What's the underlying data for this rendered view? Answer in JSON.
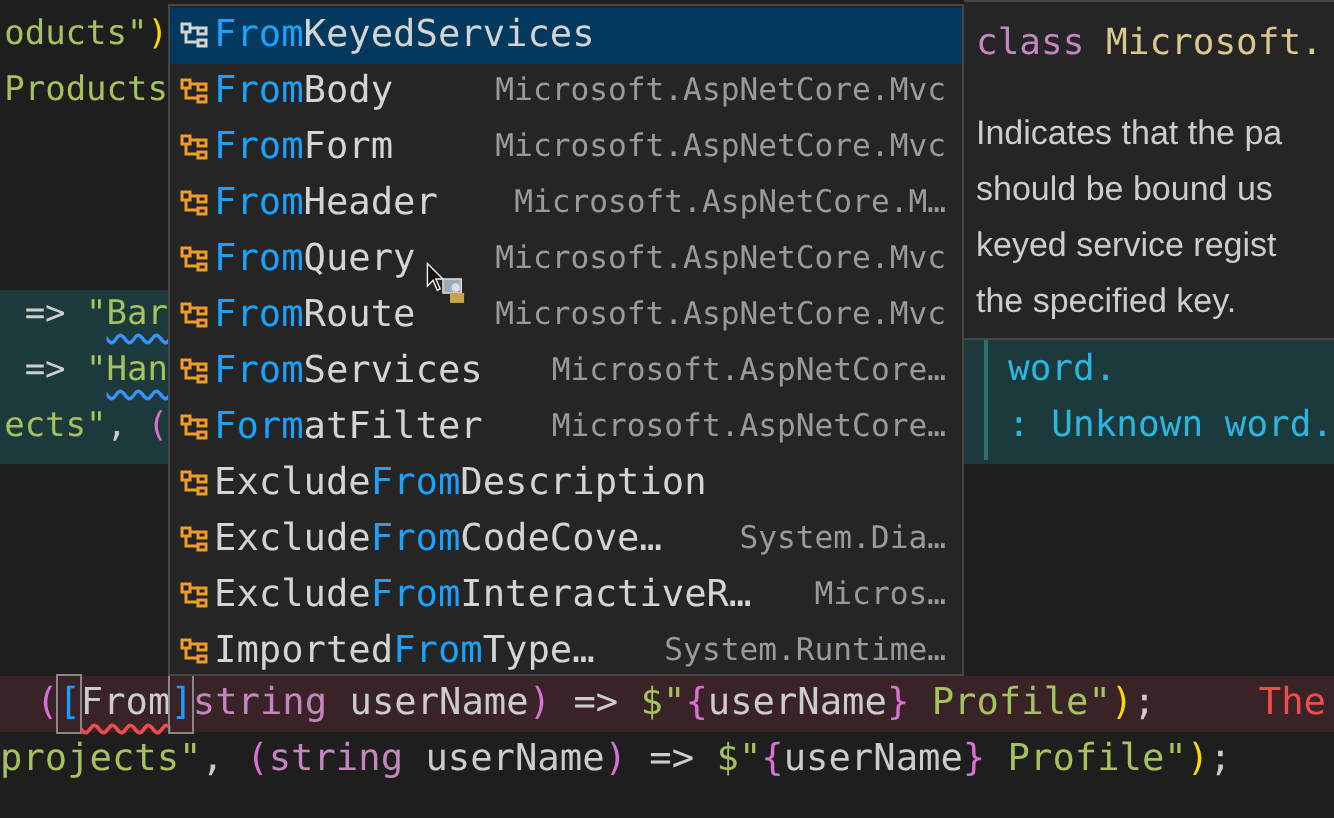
{
  "editor": {
    "top_lines": [
      {
        "tokens": [
          {
            "text": "oducts\"",
            "kind": "string"
          },
          {
            "text": ")",
            "kind": "bracket1"
          }
        ]
      },
      {
        "tokens": [
          {
            "text": "Products",
            "kind": "string"
          }
        ]
      }
    ],
    "middle_lines": [
      {
        "tokens": [
          {
            "text": "=> ",
            "kind": "plain"
          },
          {
            "text": "\"",
            "kind": "string"
          },
          {
            "text": "Bar",
            "kind": "string",
            "spelling_issue": true
          }
        ]
      },
      {
        "tokens": [
          {
            "text": "=> ",
            "kind": "plain"
          },
          {
            "text": "\"",
            "kind": "string"
          },
          {
            "text": "Han",
            "kind": "string",
            "spelling_issue": true
          }
        ]
      },
      {
        "tokens": [
          {
            "text": "ects\"",
            "kind": "string"
          },
          {
            "text": ", ",
            "kind": "plain"
          },
          {
            "text": "(",
            "kind": "bracket2"
          }
        ]
      }
    ],
    "bottom_lines": [
      {
        "error": true,
        "message": "The",
        "tokens": [
          {
            "text": "(",
            "kind": "bracket2"
          },
          {
            "text": "[",
            "kind": "bracket_match"
          },
          {
            "text": "From",
            "kind": "plain",
            "spelling_issue": true
          },
          {
            "text": "]",
            "kind": "bracket_match"
          },
          {
            "text": "string",
            "kind": "keyword"
          },
          {
            "text": " userName",
            "kind": "plain"
          },
          {
            "text": ")",
            "kind": "bracket2"
          },
          {
            "text": " => ",
            "kind": "plain"
          },
          {
            "text": "$\"",
            "kind": "string"
          },
          {
            "text": "{",
            "kind": "bracket2"
          },
          {
            "text": "userName",
            "kind": "plain"
          },
          {
            "text": "}",
            "kind": "bracket2"
          },
          {
            "text": " Profile\"",
            "kind": "string"
          },
          {
            "text": ")",
            "kind": "bracket1"
          },
          {
            "text": ";",
            "kind": "plain"
          }
        ]
      },
      {
        "error": false,
        "tokens": [
          {
            "text": "projects\"",
            "kind": "string"
          },
          {
            "text": ", ",
            "kind": "plain"
          },
          {
            "text": "(",
            "kind": "bracket2"
          },
          {
            "text": "string",
            "kind": "keyword"
          },
          {
            "text": " userName",
            "kind": "plain"
          },
          {
            "text": ")",
            "kind": "bracket2"
          },
          {
            "text": " => ",
            "kind": "plain"
          },
          {
            "text": "$\"",
            "kind": "string"
          },
          {
            "text": "{",
            "kind": "bracket2"
          },
          {
            "text": "userName",
            "kind": "plain"
          },
          {
            "text": "}",
            "kind": "bracket2"
          },
          {
            "text": " Profile\"",
            "kind": "string"
          },
          {
            "text": ")",
            "kind": "bracket1"
          },
          {
            "text": ";",
            "kind": "plain"
          }
        ]
      }
    ]
  },
  "hover": {
    "lines": [
      "word.",
      ": Unknown word."
    ]
  },
  "suggestions": [
    {
      "selected": true,
      "label": [
        {
          "text": "From",
          "match": true
        },
        {
          "text": "KeyedServices",
          "match": false
        }
      ]
    },
    {
      "selected": false,
      "label": [
        {
          "text": "From",
          "match": true
        },
        {
          "text": "Body",
          "match": false
        }
      ],
      "detail": "Microsoft.AspNetCore.Mvc"
    },
    {
      "selected": false,
      "label": [
        {
          "text": "From",
          "match": true
        },
        {
          "text": "Form",
          "match": false
        }
      ],
      "detail": "Microsoft.AspNetCore.Mvc"
    },
    {
      "selected": false,
      "label": [
        {
          "text": "From",
          "match": true
        },
        {
          "text": "Header",
          "match": false
        }
      ],
      "detail": "Microsoft.AspNetCore.M…"
    },
    {
      "selected": false,
      "label": [
        {
          "text": "From",
          "match": true
        },
        {
          "text": "Query",
          "match": false
        }
      ],
      "detail": "Microsoft.AspNetCore.Mvc"
    },
    {
      "selected": false,
      "label": [
        {
          "text": "From",
          "match": true
        },
        {
          "text": "Route",
          "match": false
        }
      ],
      "detail": "Microsoft.AspNetCore.Mvc"
    },
    {
      "selected": false,
      "label": [
        {
          "text": "From",
          "match": true
        },
        {
          "text": "Services",
          "match": false
        }
      ],
      "detail": "Microsoft.AspNetCore…"
    },
    {
      "selected": false,
      "label": [
        {
          "text": "Form",
          "match": true
        },
        {
          "text": "atFilter",
          "match": false
        }
      ],
      "detail": "Microsoft.AspNetCore…"
    },
    {
      "selected": false,
      "label": [
        {
          "text": "Exclude",
          "match": false
        },
        {
          "text": "From",
          "match": true
        },
        {
          "text": "Description",
          "match": false
        }
      ]
    },
    {
      "selected": false,
      "label": [
        {
          "text": "Exclude",
          "match": false
        },
        {
          "text": "From",
          "match": true
        },
        {
          "text": "CodeCove…",
          "match": false
        }
      ],
      "detail": "System.Dia…"
    },
    {
      "selected": false,
      "label": [
        {
          "text": "Exclude",
          "match": false
        },
        {
          "text": "From",
          "match": true
        },
        {
          "text": "InteractiveR…",
          "match": false
        }
      ],
      "detail": "Micros…"
    },
    {
      "selected": false,
      "label": [
        {
          "text": "Imported",
          "match": false
        },
        {
          "text": "From",
          "match": true
        },
        {
          "text": "Type…",
          "match": false
        }
      ],
      "detail": "System.Runtime…"
    }
  ],
  "details": {
    "signature": [
      {
        "text": "class",
        "kind": "keyword"
      },
      {
        "text": " Microsoft.",
        "kind": "type"
      }
    ],
    "description": [
      "Indicates that the pa",
      "should be bound us",
      "keyed service regist",
      "the specified key."
    ]
  }
}
